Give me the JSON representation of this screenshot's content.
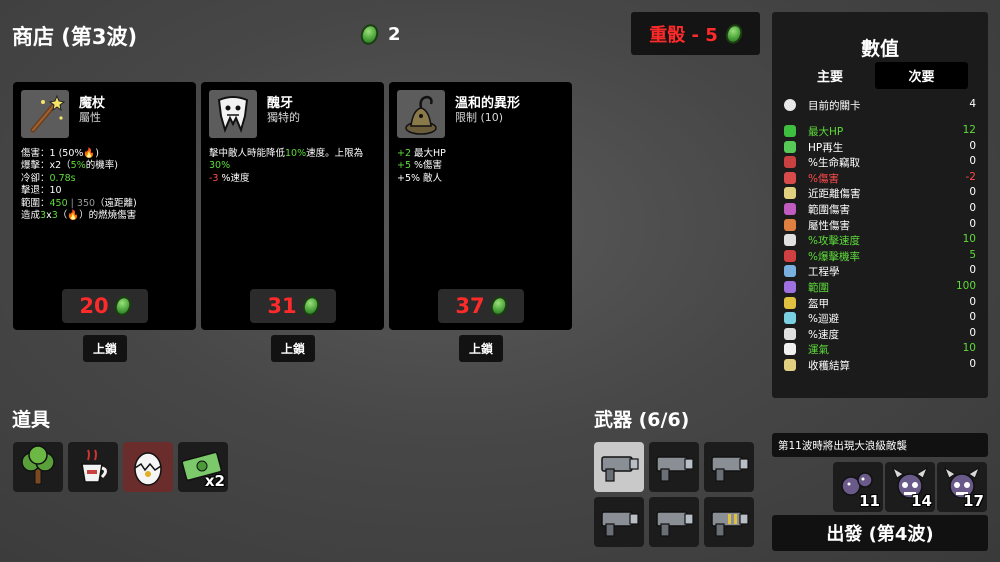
{
  "header": {
    "shop_title": "商店 (第3波)",
    "materials": "2",
    "reroll_label": "重骰 - 5"
  },
  "cards": [
    {
      "name": "魔杖",
      "sub": "屬性",
      "lines": [
        {
          "parts": [
            {
              "t": "傷害：1 (50%",
              "c": ""
            },
            {
              "t": "🔥",
              "c": "red"
            },
            {
              "t": ")",
              "c": ""
            }
          ]
        },
        {
          "parts": [
            {
              "t": "爆擊：x2（",
              "c": ""
            },
            {
              "t": "5%",
              "c": "green"
            },
            {
              "t": "的機率)",
              "c": ""
            }
          ]
        },
        {
          "parts": [
            {
              "t": "冷卻：",
              "c": ""
            },
            {
              "t": "0.78s",
              "c": "green"
            }
          ]
        },
        {
          "parts": [
            {
              "t": "擊退：10",
              "c": ""
            }
          ]
        },
        {
          "parts": [
            {
              "t": "範圍：",
              "c": ""
            },
            {
              "t": "450",
              "c": "green"
            },
            {
              "t": " | 350",
              "c": "grey"
            },
            {
              "t": "（遠距離)",
              "c": ""
            }
          ]
        },
        {
          "parts": [
            {
              "t": "造成",
              "c": ""
            },
            {
              "t": "3",
              "c": "green"
            },
            {
              "t": "x",
              "c": ""
            },
            {
              "t": "3",
              "c": "green"
            },
            {
              "t": "（🔥）的燃燒傷害",
              "c": ""
            }
          ]
        }
      ],
      "price": "20",
      "lock_label": "上鎖"
    },
    {
      "name": "醜牙",
      "sub": "獨特的",
      "lines": [
        {
          "parts": [
            {
              "t": "擊中敵人時能降低",
              "c": ""
            },
            {
              "t": "10%",
              "c": "green"
            },
            {
              "t": "速度。上限為",
              "c": ""
            }
          ]
        },
        {
          "parts": [
            {
              "t": "30%",
              "c": "green"
            }
          ]
        },
        {
          "parts": [
            {
              "t": "-3",
              "c": "red"
            },
            {
              "t": " %速度",
              "c": ""
            }
          ]
        }
      ],
      "price": "31",
      "lock_label": "上鎖"
    },
    {
      "name": "溫和的異形",
      "sub": "限制 (10)",
      "lines": [
        {
          "parts": [
            {
              "t": "+2",
              "c": "green"
            },
            {
              "t": " 最大HP",
              "c": ""
            }
          ]
        },
        {
          "parts": [
            {
              "t": "+5",
              "c": "green"
            },
            {
              "t": " %傷害",
              "c": ""
            }
          ]
        },
        {
          "parts": [
            {
              "t": "+5% 敵人",
              "c": ""
            }
          ]
        }
      ],
      "price": "37",
      "lock_label": "上鎖"
    }
  ],
  "items": {
    "title": "道具",
    "slots": [
      {
        "icon": "tree-icon",
        "qty": ""
      },
      {
        "icon": "coffee-cup-icon",
        "qty": ""
      },
      {
        "icon": "cracked-egg-icon",
        "qty": ""
      },
      {
        "icon": "cash-bundle-icon",
        "qty": "x2"
      }
    ]
  },
  "weapons": {
    "title": "武器 (6/6)",
    "slots": [
      {
        "icon": "gun-icon"
      },
      {
        "icon": "gun-icon"
      },
      {
        "icon": "gun-icon"
      },
      {
        "icon": "gun-icon"
      },
      {
        "icon": "gun-icon"
      },
      {
        "icon": "striped-gun-icon"
      }
    ]
  },
  "stats": {
    "title": "數值",
    "tab_primary": "主要",
    "tab_secondary": "次要",
    "wave_row": {
      "label": "目前的關卡",
      "value": "4",
      "icon": "skull-icon"
    },
    "rows": [
      {
        "label": "最大HP",
        "value": "12",
        "color": "#5edb3a",
        "icon": "heart-icon",
        "icolor": "#3fbf3f"
      },
      {
        "label": "HP再生",
        "value": "0",
        "color": "#ffffff",
        "icon": "regen-icon",
        "icolor": "#57c957"
      },
      {
        "label": "%生命竊取",
        "value": "0",
        "color": "#ffffff",
        "icon": "fangs-icon",
        "icolor": "#c94040"
      },
      {
        "label": "%傷害",
        "value": "-2",
        "color": "#ff4a4a",
        "icon": "damage-icon",
        "icolor": "#d94a4a"
      },
      {
        "label": "近距離傷害",
        "value": "0",
        "color": "#ffffff",
        "icon": "sword-icon",
        "icolor": "#e0d080"
      },
      {
        "label": "範圍傷害",
        "value": "0",
        "color": "#ffffff",
        "icon": "bow-icon",
        "icolor": "#c05cc0"
      },
      {
        "label": "屬性傷害",
        "value": "0",
        "color": "#ffffff",
        "icon": "flame-icon",
        "icolor": "#e08040"
      },
      {
        "label": "%攻擊速度",
        "value": "10",
        "color": "#5edb3a",
        "icon": "hourglass-icon",
        "icolor": "#e0e0e0"
      },
      {
        "label": "%爆擊機率",
        "value": "5",
        "color": "#5edb3a",
        "icon": "crit-icon",
        "icolor": "#d04040"
      },
      {
        "label": "工程學",
        "value": "0",
        "color": "#ffffff",
        "icon": "wrench-icon",
        "icolor": "#7ab0e0"
      },
      {
        "label": "範圍",
        "value": "100",
        "color": "#5edb3a",
        "icon": "range-icon",
        "icolor": "#a070e0"
      },
      {
        "label": "盔甲",
        "value": "0",
        "color": "#ffffff",
        "icon": "shield-icon",
        "icolor": "#e0c040"
      },
      {
        "label": "%迴避",
        "value": "0",
        "color": "#ffffff",
        "icon": "dodge-icon",
        "icolor": "#7ad0e0"
      },
      {
        "label": "%速度",
        "value": "0",
        "color": "#ffffff",
        "icon": "boot-icon",
        "icolor": "#e0e0e0"
      },
      {
        "label": "運氣",
        "value": "10",
        "color": "#5edb3a",
        "icon": "dice-icon",
        "icolor": "#f0f0f0"
      },
      {
        "label": "收穫結算",
        "value": "0",
        "color": "#ffffff",
        "icon": "harvest-icon",
        "icolor": "#e0d080"
      }
    ]
  },
  "wave_notice": "第11波時將出現大浪級敵襲",
  "enemies": [
    {
      "icon": "spider-enemy-icon",
      "count": "11"
    },
    {
      "icon": "horned-skull-enemy-icon",
      "count": "14"
    },
    {
      "icon": "horned-skull-enemy-icon",
      "count": "17"
    }
  ],
  "go_button": "出發 (第4波)"
}
